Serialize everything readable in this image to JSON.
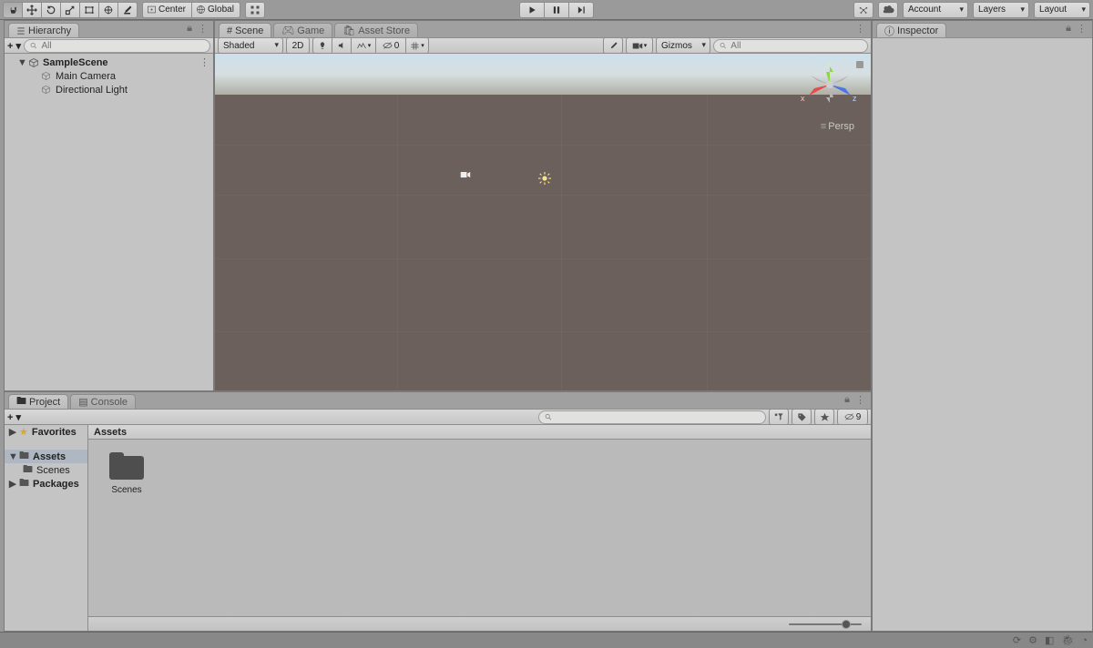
{
  "toolbar": {
    "pivot_label": "Center",
    "space_label": "Global",
    "account_label": "Account",
    "layers_label": "Layers",
    "layout_label": "Layout"
  },
  "hierarchy": {
    "tab_label": "Hierarchy",
    "search_placeholder": "All",
    "scene_name": "SampleScene",
    "items": [
      {
        "label": "Main Camera"
      },
      {
        "label": "Directional Light"
      }
    ]
  },
  "scene": {
    "tab_scene": "Scene",
    "tab_game": "Game",
    "tab_asset_store": "Asset Store",
    "shading_mode": "Shaded",
    "toggle_2d": "2D",
    "gizmos_label": "Gizmos",
    "search_placeholder": "All",
    "axis_x": "x",
    "axis_y": "y",
    "axis_z": "z",
    "persp_label": "Persp",
    "hidden_count": "0"
  },
  "inspector": {
    "tab_label": "Inspector"
  },
  "project": {
    "tab_project": "Project",
    "tab_console": "Console",
    "breadcrumb": "Assets",
    "left_tree": {
      "favorites": "Favorites",
      "assets": "Assets",
      "scenes": "Scenes",
      "packages": "Packages"
    },
    "grid_items": [
      {
        "label": "Scenes"
      }
    ],
    "hidden_badge": "9"
  }
}
